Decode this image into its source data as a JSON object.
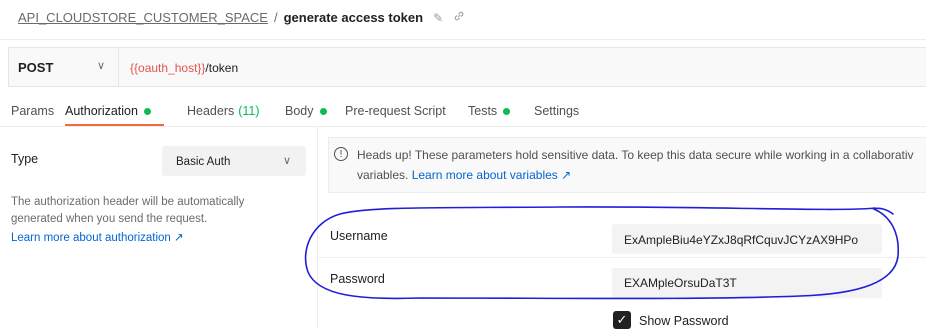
{
  "breadcrumb": {
    "collection": "API_CLOUDSTORE_CUSTOMER_SPACE",
    "separator": "/",
    "request": "generate access token",
    "edit_icon": "✎",
    "link_icon": "🔗"
  },
  "request": {
    "method": "POST",
    "method_chevron": "∨",
    "url_variable": "{{oauth_host}}",
    "url_path": "/token"
  },
  "tabs": [
    {
      "label": "Params",
      "dot": false,
      "count": ""
    },
    {
      "label": "Authorization",
      "dot": true,
      "count": ""
    },
    {
      "label": "Headers",
      "dot": false,
      "count": "(11)"
    },
    {
      "label": "Body",
      "dot": true,
      "count": ""
    },
    {
      "label": "Pre-request Script",
      "dot": false,
      "count": ""
    },
    {
      "label": "Tests",
      "dot": true,
      "count": ""
    },
    {
      "label": "Settings",
      "dot": false,
      "count": ""
    }
  ],
  "active_tab": "Authorization",
  "auth": {
    "type_label": "Type",
    "type_value": "Basic Auth",
    "type_chevron": "∨",
    "description": "The authorization header will be automatically generated when you send the request.",
    "learn_more": "Learn more about authorization ↗"
  },
  "banner": {
    "icon": "!",
    "line1": "Heads up! These parameters hold sensitive data. To keep this data secure while working in a collaborativ",
    "line2_prefix": "variables.",
    "link": "Learn more about variables ↗"
  },
  "fields": {
    "username_label": "Username",
    "username_value": "ExAmpleBiu4eYZxJ8qRfCquvJCYzAX9HPo",
    "password_label": "Password",
    "password_value": "EXAMpleOrsuDaT3T",
    "show_password_label": "Show Password",
    "show_password_checked": true,
    "check_glyph": "✓"
  },
  "colors": {
    "accent_orange": "#f26b3a",
    "green_dot": "#0cbb52",
    "link_blue": "#0265d2",
    "variable_red": "#e0554d",
    "annotation_blue": "#1f1fd8"
  }
}
